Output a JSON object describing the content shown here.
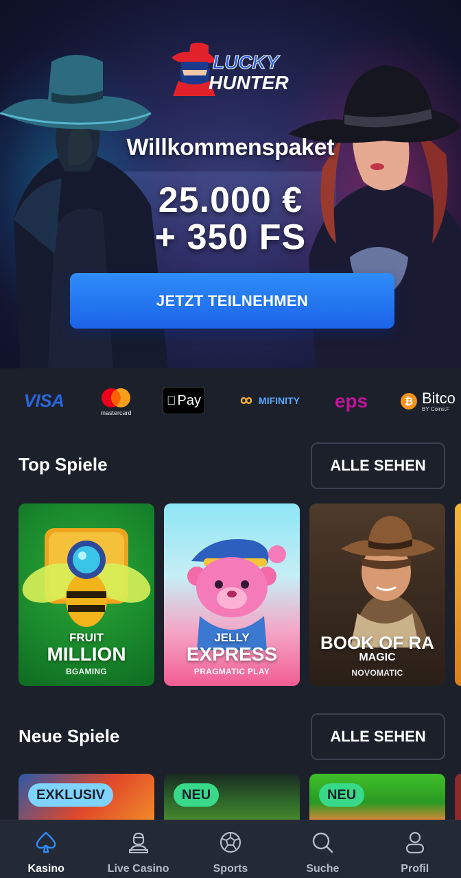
{
  "hero": {
    "logo_line1": "LUCKY",
    "logo_line2": "HUNTER",
    "title": "Willkommenspaket",
    "amount_line1": "25.000 €",
    "amount_line2": "+ 350 FS",
    "cta_label": "JETZT TEILNEHMEN"
  },
  "payments": [
    {
      "name": "visa-logo",
      "label": "VISA"
    },
    {
      "name": "mastercard-logo",
      "label": "mastercard"
    },
    {
      "name": "apple-pay-logo",
      "label": "Pay"
    },
    {
      "name": "mifinity-logo",
      "label": "MIFINITY"
    },
    {
      "name": "eps-logo",
      "label": "eps"
    },
    {
      "name": "bitcoin-logo",
      "label": "Bitco",
      "sub": "BY Coins.F"
    }
  ],
  "top_games": {
    "title": "Top Spiele",
    "see_all": "ALLE SEHEN",
    "games": [
      {
        "line1": "FRUIT",
        "line2": "MILLION",
        "provider": "BGAMING"
      },
      {
        "line1": "JELLY",
        "line2": "EXPRESS",
        "provider": "PRAGMATIC PLAY"
      },
      {
        "line1": "BOOK OF RA",
        "line2": "MAGIC",
        "provider": "NOVOMATIC"
      }
    ]
  },
  "new_games": {
    "title": "Neue Spiele",
    "see_all": "ALLE SEHEN",
    "badges": [
      "EXKLUSIV",
      "NEU",
      "NEU"
    ]
  },
  "bottom_nav": [
    {
      "label": "Kasino",
      "icon": "spade-icon",
      "active": true
    },
    {
      "label": "Live Casino",
      "icon": "dealer-icon",
      "active": false
    },
    {
      "label": "Sports",
      "icon": "soccer-ball-icon",
      "active": false
    },
    {
      "label": "Suche",
      "icon": "search-icon",
      "active": false
    },
    {
      "label": "Profil",
      "icon": "user-icon",
      "active": false
    }
  ],
  "colors": {
    "background": "#1b202b",
    "cta": "#1f6ef0",
    "nav_active": "#2f8df9",
    "badge_exklusiv": "#7fd3ff",
    "badge_neu": "#39d98a"
  }
}
